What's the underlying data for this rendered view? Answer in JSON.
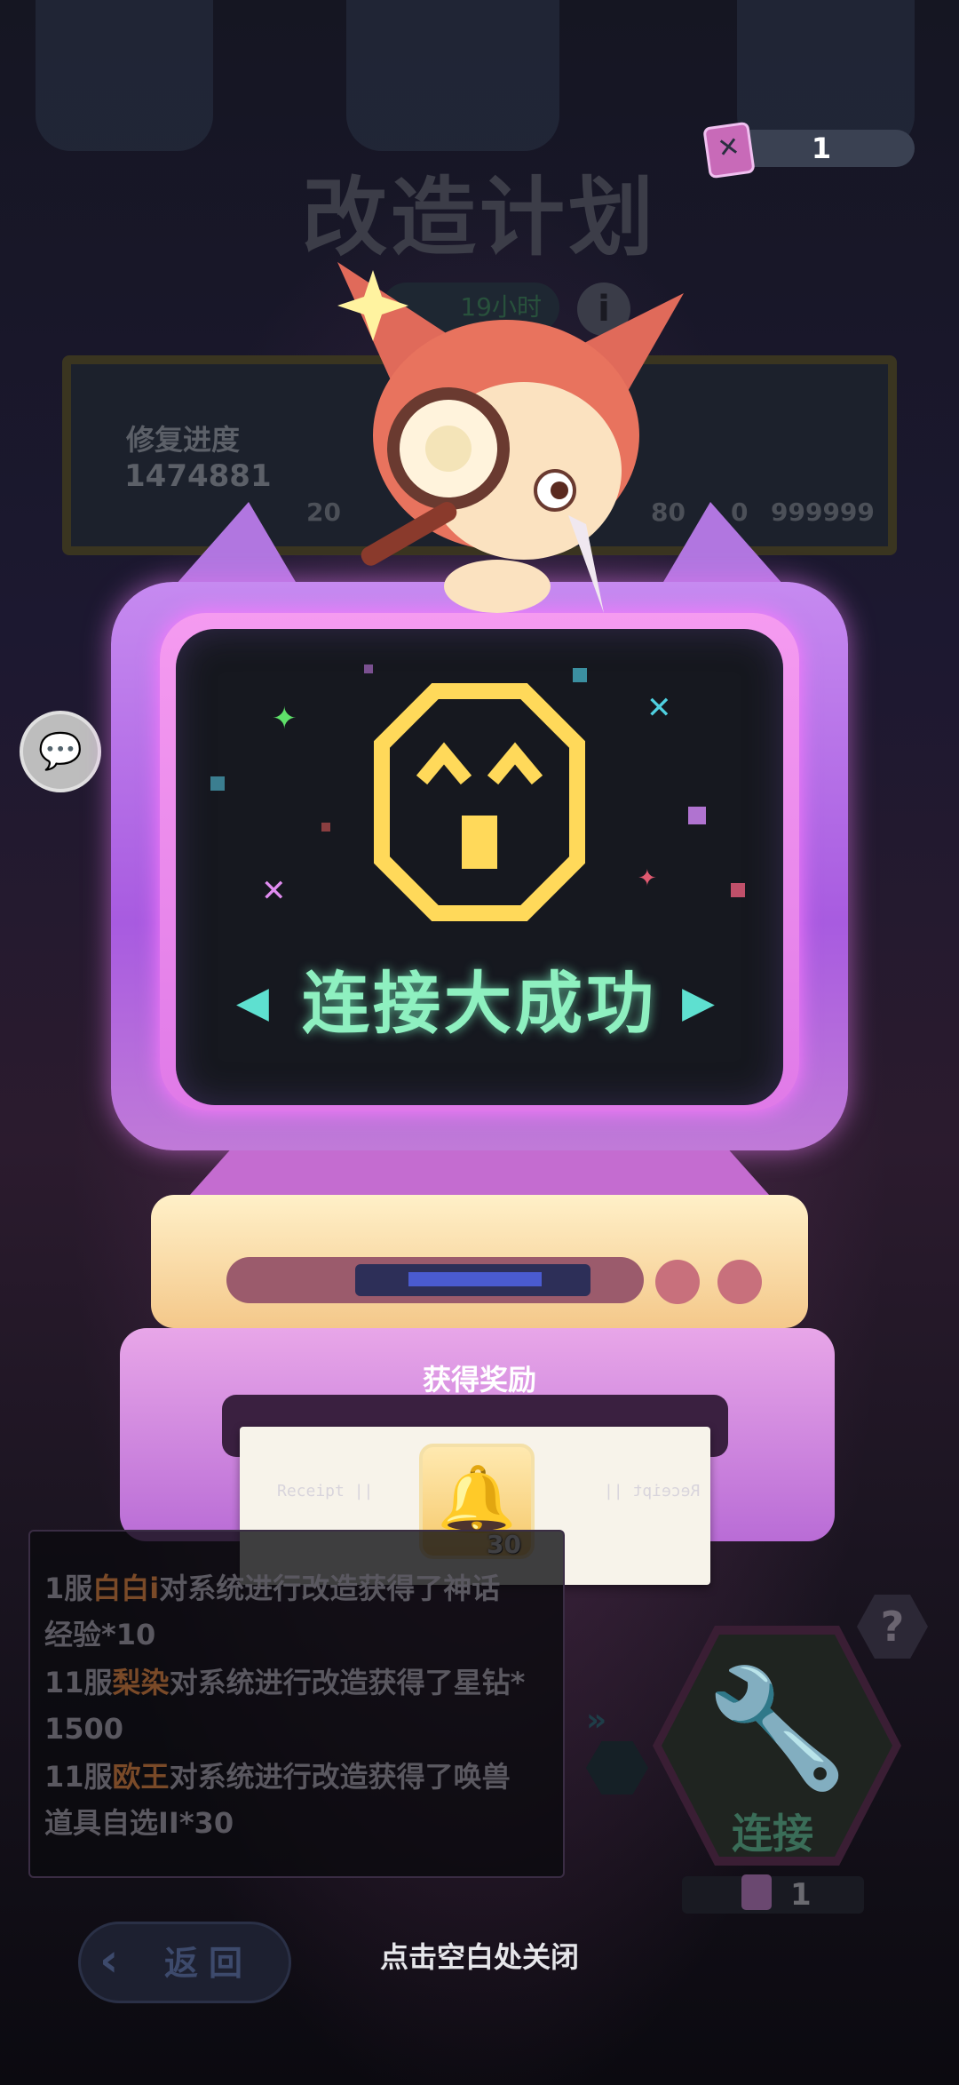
{
  "currency": {
    "icon": "wrench-card-icon",
    "value": "1"
  },
  "plan": {
    "title": "改造计划",
    "timer": "19小时",
    "info_glyph": "i"
  },
  "repair": {
    "label": "修复进度",
    "value": "1474881",
    "milestones": [
      "20",
      "80",
      "0",
      "999999"
    ]
  },
  "screen": {
    "message": "连接大成功",
    "face_icon": "happy-pixel-face-icon"
  },
  "reward": {
    "title": "获得奖励",
    "receipt_left": "Receipt ||",
    "receipt_right": "Receipt ||",
    "item": {
      "icon": "golden-bell-icon",
      "count": "30"
    }
  },
  "log": {
    "lines": [
      {
        "pre": "1服",
        "name": "白白i",
        "post": "对系统进行改造获得了神话"
      },
      {
        "pre": "",
        "name": "",
        "post": "经验*10"
      },
      {
        "pre": "11服",
        "name": "梨染",
        "post": "对系统进行改造获得了星钻*"
      },
      {
        "pre": "",
        "name": "",
        "post": "1500"
      },
      {
        "pre": "11服",
        "name": "欧王",
        "post": "对系统进行改造获得了唤兽"
      },
      {
        "pre": "",
        "name": "",
        "post": "道具自选II*30"
      }
    ]
  },
  "connect": {
    "label": "连接",
    "cost": "1",
    "help_glyph": "?"
  },
  "nav": {
    "back_label": "返回",
    "close_hint": "点击空白处关闭"
  },
  "colors": {
    "accent_green": "#8ef0c0",
    "monitor_purple": "#b176e0",
    "face_yellow": "#ffd95a"
  }
}
